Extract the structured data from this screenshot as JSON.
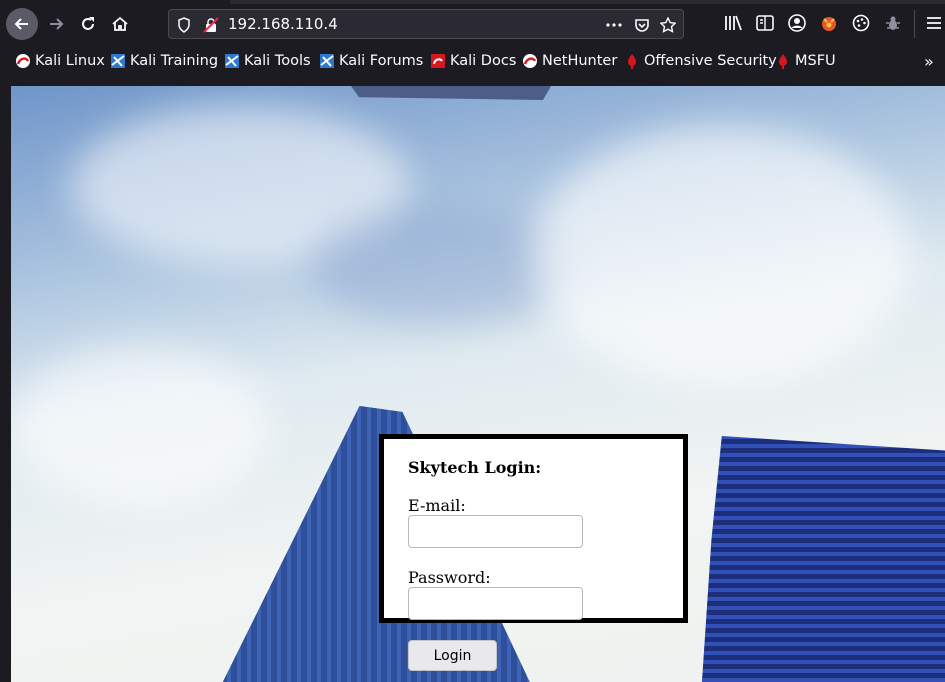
{
  "browser": {
    "url": "192.168.110.4",
    "nav": {
      "back": "back-arrow-icon",
      "forward": "forward-arrow-icon",
      "reload": "reload-icon",
      "home": "home-icon"
    },
    "url_icons": [
      "shield-icon",
      "insecure-lock-icon",
      "more-dots-icon",
      "pocket-icon",
      "star-icon"
    ],
    "toolbar_icons": [
      "library-icon",
      "reader-view-icon",
      "account-icon",
      "extension-fox-icon",
      "extension-palette-icon",
      "extension-bug-icon",
      "hamburger-menu-icon"
    ],
    "bookmarks": [
      {
        "label": "Kali Linux",
        "icon": "kali-dragon-icon"
      },
      {
        "label": "Kali Training",
        "icon": "kali-training-icon"
      },
      {
        "label": "Kali Tools",
        "icon": "kali-tools-icon"
      },
      {
        "label": "Kali Forums",
        "icon": "kali-forums-icon"
      },
      {
        "label": "Kali Docs",
        "icon": "kali-docs-icon"
      },
      {
        "label": "NetHunter",
        "icon": "nethunter-icon"
      },
      {
        "label": "Offensive Security",
        "icon": "offsec-icon"
      },
      {
        "label": "MSFU",
        "icon": "msfu-icon"
      }
    ],
    "bookmarks_overflow": "»",
    "colors": {
      "chrome_bg": "#1c1b22",
      "url_bg": "#2b2a33",
      "text": "#fbfbfe"
    }
  },
  "page": {
    "login": {
      "title": "Skytech Login:",
      "email_label": "E-mail:",
      "email_value": "",
      "password_label": "Password:",
      "password_value": "",
      "button_label": "Login"
    },
    "colors": {
      "box_border": "#000000",
      "box_bg": "#ffffff"
    }
  }
}
